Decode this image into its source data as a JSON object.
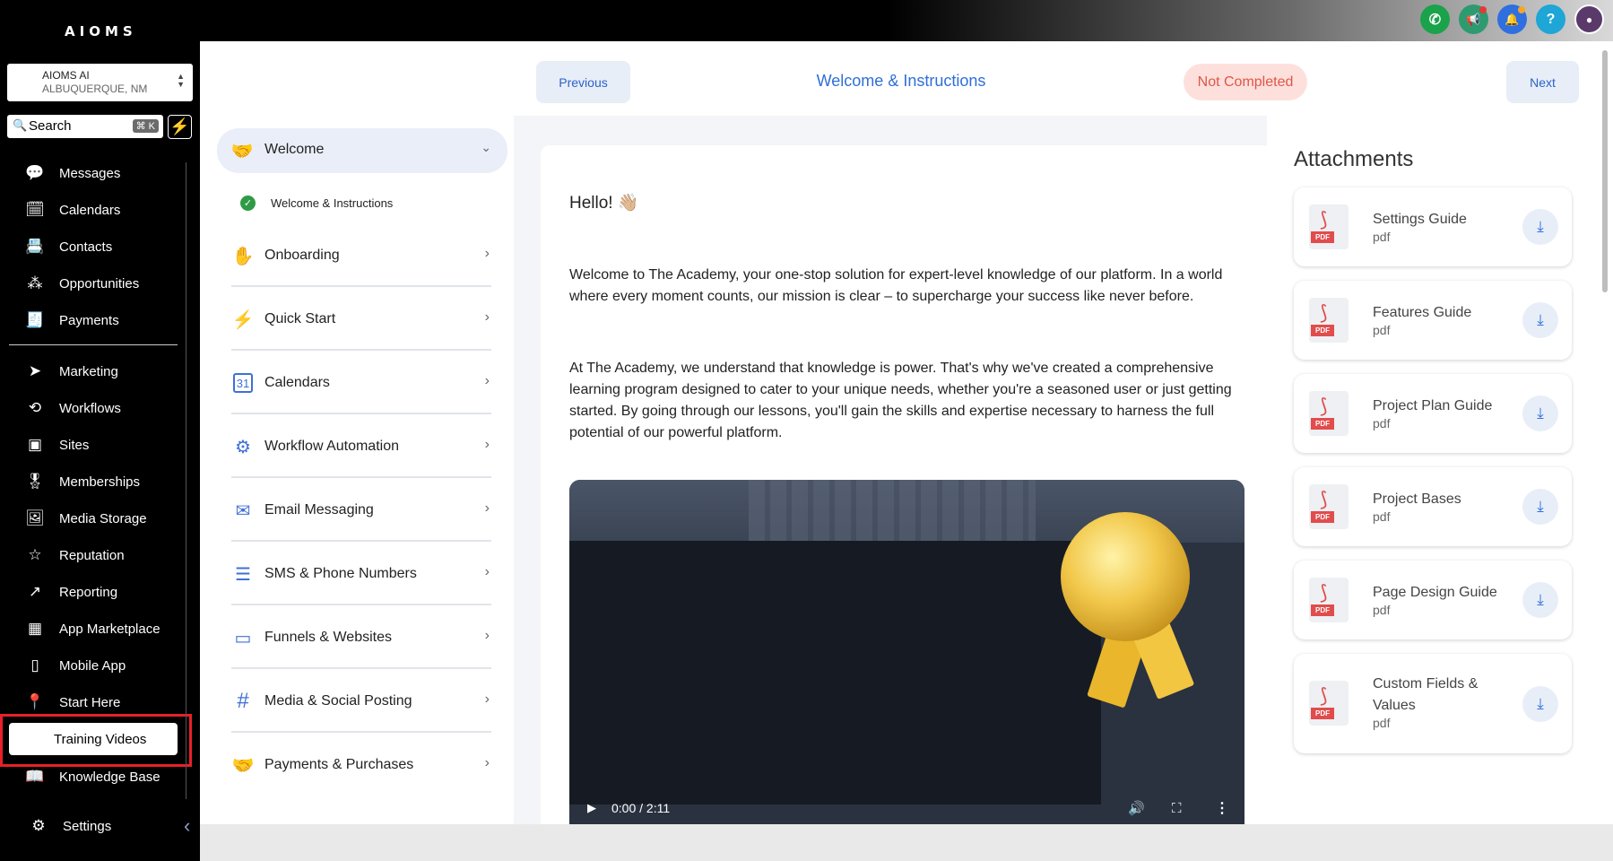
{
  "app": {
    "logo": "AIOMS"
  },
  "topbar": {
    "icons": [
      {
        "name": "phone-icon",
        "glyph": "✆",
        "color": "#1aa34a"
      },
      {
        "name": "megaphone-icon",
        "glyph": "📢",
        "color": "#2e9a70"
      },
      {
        "name": "bell-icon",
        "glyph": "🔔",
        "color": "#2f6fe0"
      },
      {
        "name": "help-icon",
        "glyph": "?",
        "color": "#1ea6d6"
      },
      {
        "name": "avatar",
        "glyph": "●",
        "color": "#5a3a6a"
      }
    ]
  },
  "sidebar": {
    "location_name": "AIOMS AI",
    "location_city": "ALBUQUERQUE, NM",
    "search_label": "Search",
    "search_shortcut": "⌘ K",
    "items": [
      {
        "label": "Messages",
        "icon": "💬"
      },
      {
        "label": "Calendars",
        "icon": "🗓"
      },
      {
        "label": "Contacts",
        "icon": "📇"
      },
      {
        "label": "Opportunities",
        "icon": "⁂"
      },
      {
        "label": "Payments",
        "icon": "🧾"
      },
      {
        "label": "Marketing",
        "icon": "➤"
      },
      {
        "label": "Workflows",
        "icon": "⟲"
      },
      {
        "label": "Sites",
        "icon": "▣"
      },
      {
        "label": "Memberships",
        "icon": "🎖"
      },
      {
        "label": "Media Storage",
        "icon": "🖼"
      },
      {
        "label": "Reputation",
        "icon": "☆"
      },
      {
        "label": "Reporting",
        "icon": "↗"
      },
      {
        "label": "App Marketplace",
        "icon": "▦"
      },
      {
        "label": "Mobile App",
        "icon": "▯"
      },
      {
        "label": "Start Here",
        "icon": "📍"
      },
      {
        "label": "Training Videos",
        "icon": ""
      },
      {
        "label": "Knowledge Base",
        "icon": "📖"
      }
    ],
    "settings_label": "Settings"
  },
  "lesson_nav": {
    "previous_label": "Previous",
    "title": "Welcome & Instructions",
    "status": "Not Completed",
    "next_label": "Next"
  },
  "modules": {
    "welcome": "Welcome",
    "welcome_lesson": "Welcome & Instructions",
    "list": [
      {
        "label": "Onboarding",
        "icon": "✋"
      },
      {
        "label": "Quick Start",
        "icon": "⚡"
      },
      {
        "label": "Calendars",
        "icon": "31"
      },
      {
        "label": "Workflow Automation",
        "icon": "⚙"
      },
      {
        "label": "Email Messaging",
        "icon": "✉"
      },
      {
        "label": "SMS & Phone Numbers",
        "icon": "☰"
      },
      {
        "label": "Funnels & Websites",
        "icon": "▭"
      },
      {
        "label": "Media & Social Posting",
        "icon": "#"
      },
      {
        "label": "Payments & Purchases",
        "icon": "🤝"
      }
    ]
  },
  "content": {
    "greeting": "Hello! 👋🏼",
    "paragraph1": "Welcome to The Academy, your one-stop solution for expert-level knowledge of our platform. In a world where every moment counts, our mission is clear – to supercharge your success like never before.",
    "paragraph2": "At The Academy, we understand that knowledge is power. That's why we've created a comprehensive learning program designed to cater to your unique needs, whether you're a seasoned user or just getting started. By going through our lessons, you'll gain the skills and expertise necessary to harness the full potential of our powerful platform.",
    "video_time": "0:00 / 2:11",
    "video_progress": 0
  },
  "attachments": {
    "title": "Attachments",
    "pdf_tag": "PDF",
    "items": [
      {
        "name": "Settings Guide",
        "ext": "pdf"
      },
      {
        "name": "Features Guide",
        "ext": "pdf"
      },
      {
        "name": "Project Plan Guide",
        "ext": "pdf"
      },
      {
        "name": "Project Bases",
        "ext": "pdf"
      },
      {
        "name": "Page Design Guide",
        "ext": "pdf"
      },
      {
        "name": "Custom Fields & Values",
        "ext": "pdf"
      }
    ]
  }
}
